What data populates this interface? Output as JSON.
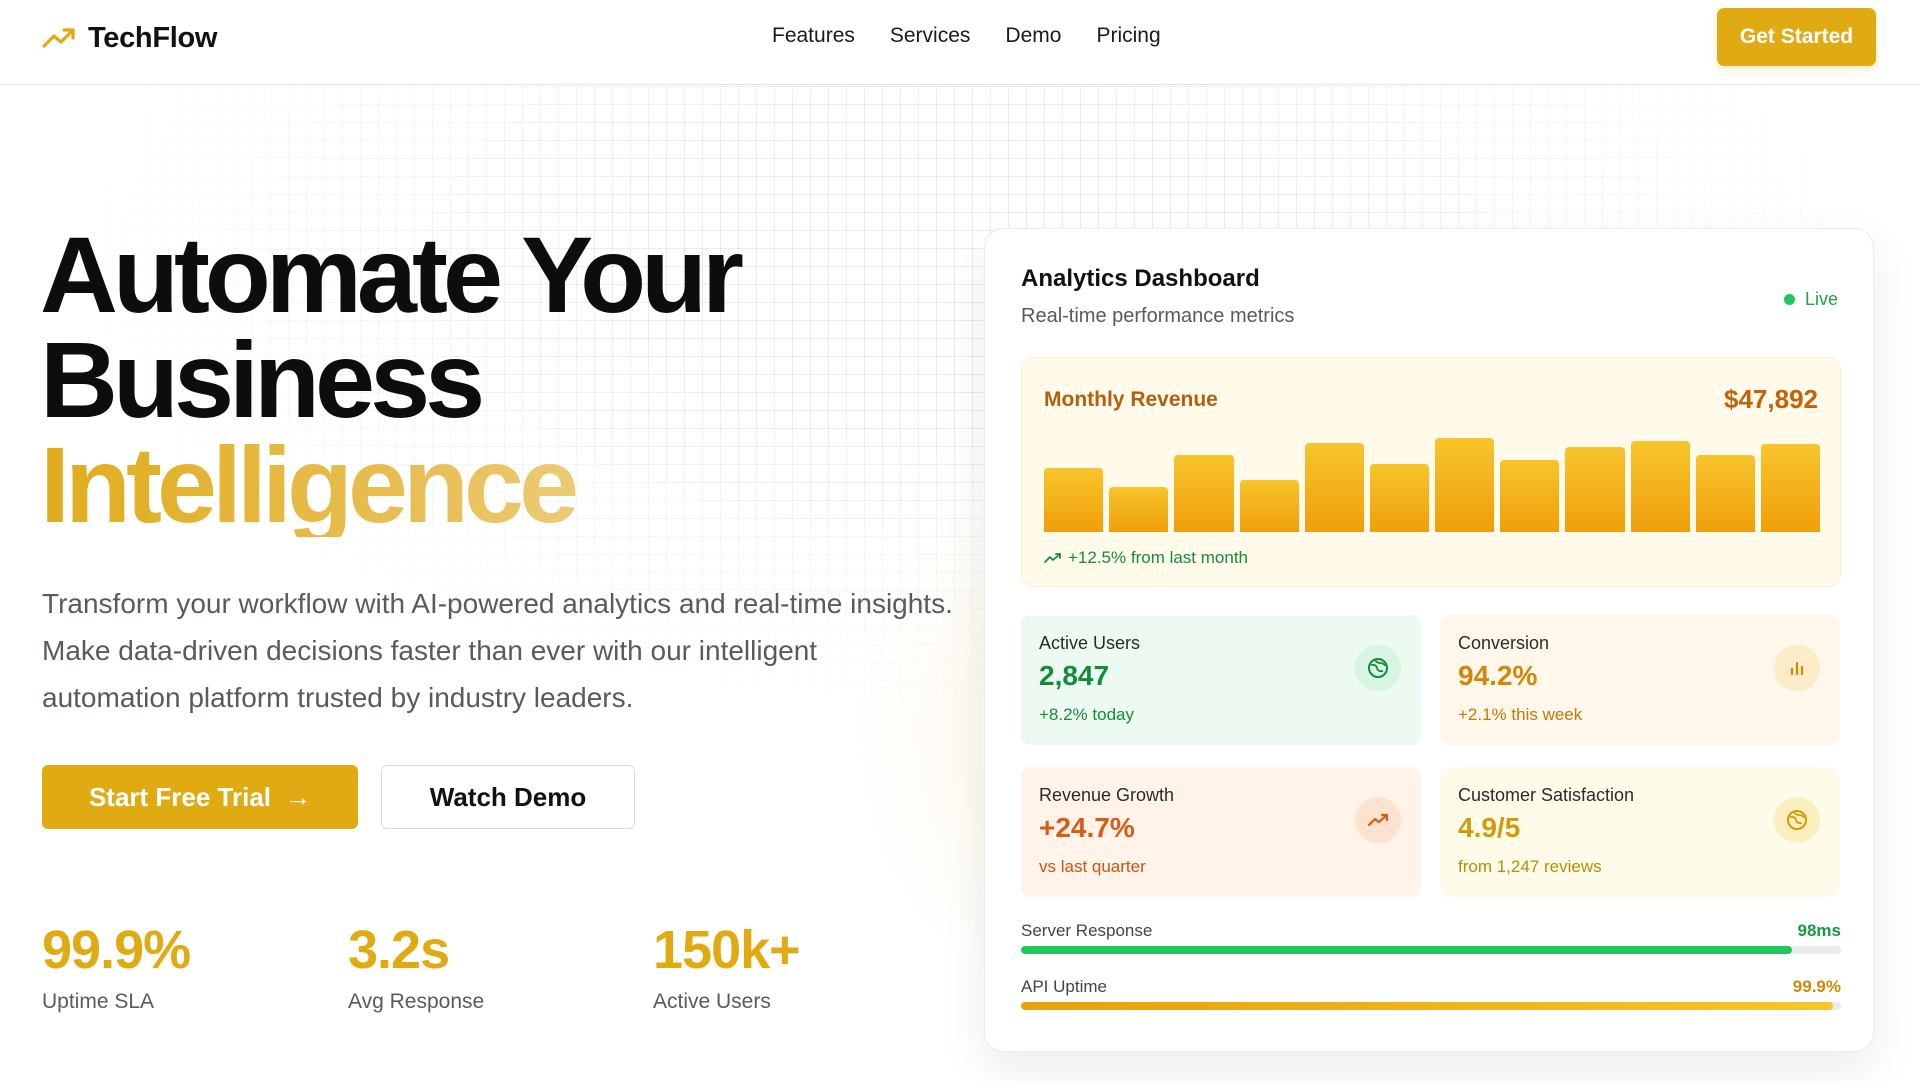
{
  "header": {
    "brand": "TechFlow",
    "nav": [
      "Features",
      "Services",
      "Demo",
      "Pricing"
    ],
    "cta": "Get Started"
  },
  "hero": {
    "title_line1": "Automate Your",
    "title_line2": "Business",
    "title_line3": "Intelligence",
    "description": "Transform your workflow with AI-powered analytics and real-time insights. Make data-driven decisions faster than ever with our intelligent automation platform trusted by industry leaders.",
    "primary_button": "Start Free Trial",
    "primary_button_icon": "→",
    "secondary_button": "Watch Demo",
    "stats": [
      {
        "value": "99.9%",
        "label": "Uptime SLA"
      },
      {
        "value": "3.2s",
        "label": "Avg Response"
      },
      {
        "value": "150k+",
        "label": "Active Users"
      }
    ]
  },
  "dashboard": {
    "title": "Analytics Dashboard",
    "subtitle": "Real-time performance metrics",
    "status": "Live",
    "revenue": {
      "label": "Monthly Revenue",
      "amount": "$47,892",
      "change": "+12.5% from last month",
      "bar_levels": [
        0.68,
        0.48,
        0.82,
        0.55,
        0.95,
        0.72,
        1.0,
        0.77,
        0.9,
        0.97,
        0.82,
        0.94
      ]
    },
    "metrics": [
      {
        "label": "Active Users",
        "value": "2,847",
        "note": "+8.2% today",
        "icon": "globe-icon",
        "tone": "green"
      },
      {
        "label": "Conversion",
        "value": "94.2%",
        "note": "+2.1% this week",
        "icon": "bar-chart-icon",
        "tone": "amber"
      },
      {
        "label": "Revenue Growth",
        "value": "+24.7%",
        "note": "vs last quarter",
        "icon": "trending-up-icon",
        "tone": "orange"
      },
      {
        "label": "Customer Satisfaction",
        "value": "4.9/5",
        "note": "from 1,247 reviews",
        "icon": "globe-icon",
        "tone": "yellow"
      }
    ],
    "server_response": {
      "label": "Server Response",
      "value": "98ms",
      "fraction": 0.94
    },
    "api_uptime": {
      "label": "API Uptime",
      "value": "99.9%",
      "fraction": 0.99
    }
  },
  "colors": {
    "accent": "#e0ab12",
    "green": "#22c55e",
    "text_muted": "#555b63"
  }
}
